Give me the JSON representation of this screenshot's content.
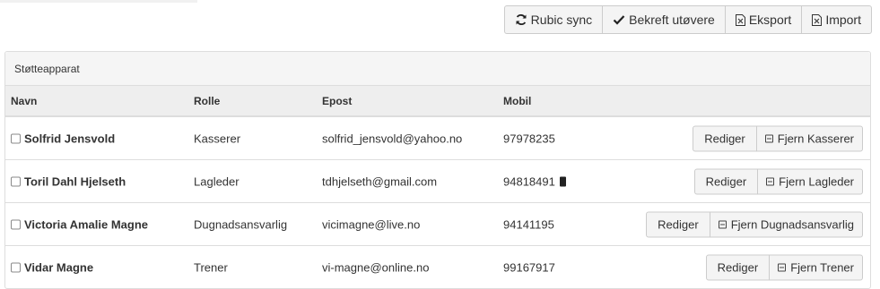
{
  "toolbar": {
    "buttons": [
      {
        "label": "Rubic sync",
        "icon": "refresh-icon"
      },
      {
        "label": "Bekreft utøvere",
        "icon": "checkmark-icon"
      },
      {
        "label": "Eksport",
        "icon": "excel-file-icon"
      },
      {
        "label": "Import",
        "icon": "excel-file-icon"
      }
    ]
  },
  "panel": {
    "title": "Støtteapparat",
    "columns": {
      "name": "Navn",
      "role": "Rolle",
      "email": "Epost",
      "mobile": "Mobil"
    },
    "rows": [
      {
        "name": "Solfrid Jensvold",
        "role": "Kasserer",
        "email": "solfrid_jensvold@yahoo.no",
        "mobile": "97978235",
        "edit_label": "Rediger",
        "remove_label": "Fjern Kasserer"
      },
      {
        "name": "Toril Dahl Hjelseth",
        "role": "Lagleder",
        "email": "tdhjelseth@gmail.com",
        "mobile": "94818491",
        "edit_label": "Rediger",
        "remove_label": "Fjern Lagleder"
      },
      {
        "name": "Victoria Amalie Magne",
        "role": "Dugnadsansvarlig",
        "email": "vicimagne@live.no",
        "mobile": "94141195",
        "edit_label": "Rediger",
        "remove_label": "Fjern Dugnadsansvarlig"
      },
      {
        "name": "Vidar Magne",
        "role": "Trener",
        "email": "vi-magne@online.no",
        "mobile": "99167917",
        "edit_label": "Rediger",
        "remove_label": "Fjern Trener"
      }
    ]
  }
}
